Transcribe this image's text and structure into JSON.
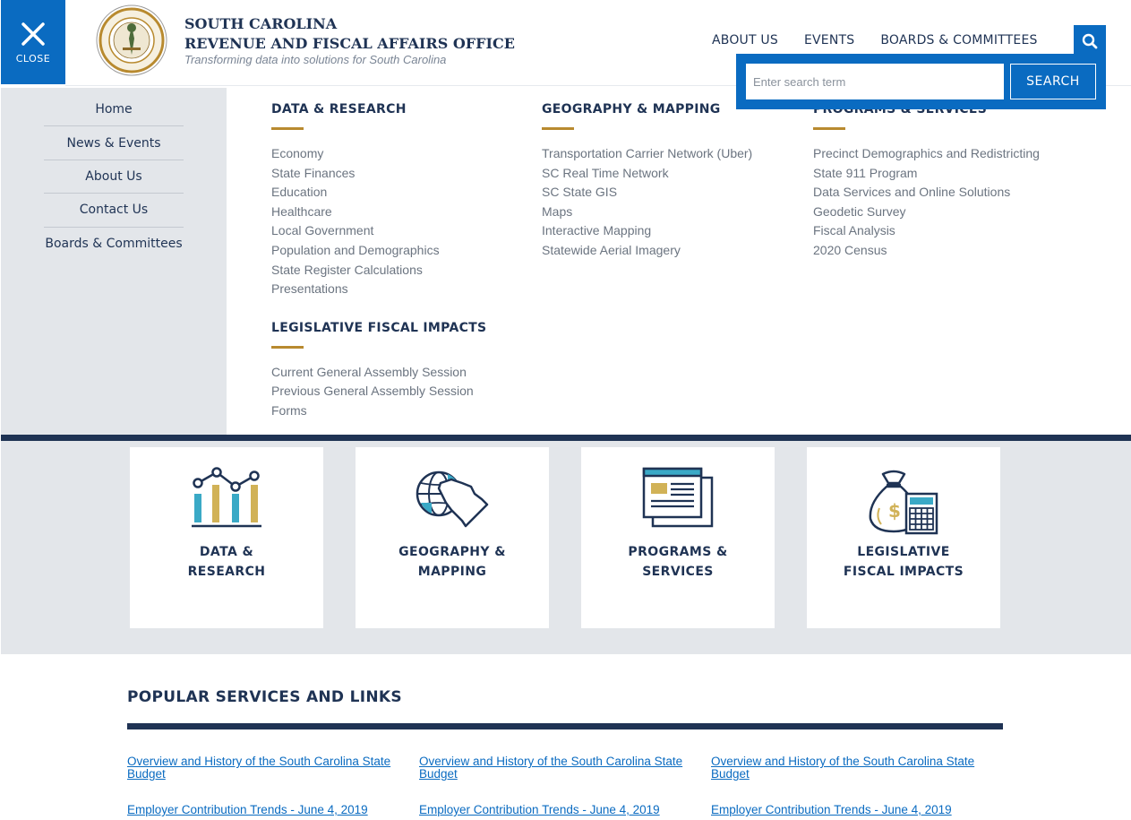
{
  "close": {
    "label": "CLOSE"
  },
  "brand": {
    "line1": "SOUTH CAROLINA",
    "line2": "REVENUE AND FISCAL AFFAIRS OFFICE",
    "tagline": "Transforming data into solutions for South Carolina"
  },
  "topnav": [
    "ABOUT US",
    "EVENTS",
    "BOARDS & COMMITTEES"
  ],
  "search": {
    "placeholder": "Enter search term",
    "button": "SEARCH"
  },
  "sidenav": [
    "Home",
    "News & Events",
    "About Us",
    "Contact Us",
    "Boards & Committees"
  ],
  "menu": {
    "col1": {
      "heading": "DATA & RESEARCH",
      "items": [
        "Economy",
        "State Finances",
        "Education",
        "Healthcare",
        "Local Government",
        "Population and Demographics",
        "State Register Calculations",
        "Presentations"
      ],
      "heading2": "LEGISLATIVE FISCAL IMPACTS",
      "items2": [
        "Current General Assembly Session",
        "Previous General Assembly Session",
        "Forms"
      ]
    },
    "col2": {
      "heading": "GEOGRAPHY & MAPPING",
      "items": [
        "Transportation Carrier Network (Uber)",
        "SC Real Time Network",
        "SC State GIS",
        "Maps",
        "Interactive Mapping",
        "Statewide Aerial Imagery"
      ]
    },
    "col3": {
      "heading": "PROGRAMS & SERVICES",
      "items": [
        "Precinct Demographics and Redistricting",
        "State 911 Program",
        "Data Services and Online Solutions",
        "Geodetic Survey",
        "Fiscal Analysis",
        "2020 Census"
      ]
    }
  },
  "cards": [
    {
      "line1": "DATA &",
      "line2": "RESEARCH",
      "icon": "chart-icon"
    },
    {
      "line1": "GEOGRAPHY &",
      "line2": "MAPPING",
      "icon": "globe-map-icon"
    },
    {
      "line1": "PROGRAMS &",
      "line2": "SERVICES",
      "icon": "documents-icon"
    },
    {
      "line1": "LEGISLATIVE",
      "line2": "FISCAL IMPACTS",
      "icon": "money-bag-calculator-icon"
    }
  ],
  "popular": {
    "heading": "POPULAR SERVICES AND LINKS",
    "columns": [
      [
        "Overview and History of the South Carolina State Budget",
        "Employer Contribution Trends - June 4, 2019"
      ],
      [
        "Overview and History of the South Carolina State Budget",
        "Employer Contribution Trends - June 4, 2019"
      ],
      [
        "Overview and History of the South Carolina State Budget",
        "Employer Contribution Trends - June 4, 2019"
      ]
    ]
  },
  "colors": {
    "brand_blue": "#0a6bc1",
    "navy": "#1f3354",
    "gold": "#b88a2f",
    "teal": "#3aa9c6",
    "gray_bg": "#e3e6ea"
  }
}
